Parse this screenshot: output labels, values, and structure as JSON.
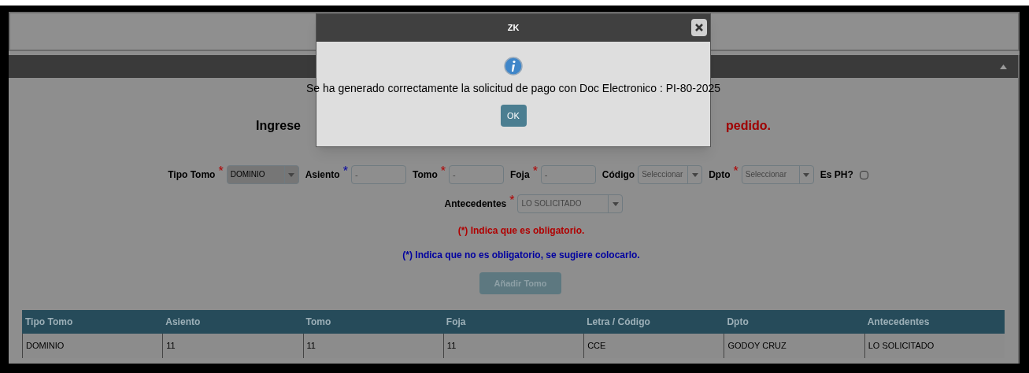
{
  "dialog": {
    "title": "ZK",
    "message": "Se ha generado correctamente la solicitud de pago con Doc Electronico : PI-80-2025",
    "ok_label": "OK"
  },
  "heading": {
    "left": "Ingrese",
    "right": "pedido."
  },
  "fields": [
    {
      "kind": "select",
      "label": "Tipo Tomo",
      "asterisk": "*",
      "required": true,
      "value": "DOMINIO",
      "selected": true
    },
    {
      "kind": "input",
      "label": "Asiento",
      "asterisk": "*",
      "required": false,
      "value": "-"
    },
    {
      "kind": "input",
      "label": "Tomo",
      "asterisk": "*",
      "required": true,
      "value": "-"
    },
    {
      "kind": "input",
      "label": "Foja",
      "asterisk": "*",
      "required": true,
      "value": "-"
    },
    {
      "kind": "select",
      "label": "Código",
      "value": "Seleccionar",
      "selected": false
    },
    {
      "kind": "select",
      "label": "Dpto",
      "asterisk": "*",
      "required": true,
      "value": "Seleccionar",
      "selected": false
    },
    {
      "kind": "checkbox",
      "label": "Es PH?",
      "checked": false
    }
  ],
  "antecedentes": {
    "label": "Antecedentes",
    "asterisk": "*",
    "required": true,
    "value": "LO SOLICITADO"
  },
  "notes": [
    {
      "text": "(*) Indica que es obligatorio.",
      "required": true
    },
    {
      "text": "(*) Indica que no es obligatorio, se sugiere colocarlo.",
      "required": false
    }
  ],
  "add_button": {
    "label": "Añadir Tomo",
    "disabled": true
  },
  "table": {
    "columns": [
      "Tipo Tomo",
      "Asiento",
      "Tomo",
      "Foja",
      "Letra / Código",
      "Dpto",
      "Antecedentes"
    ],
    "rows": [
      [
        "DOMINIO",
        "11",
        "11",
        "11",
        "CCE",
        "GODOY CRUZ",
        "LO SOLICITADO"
      ]
    ]
  }
}
